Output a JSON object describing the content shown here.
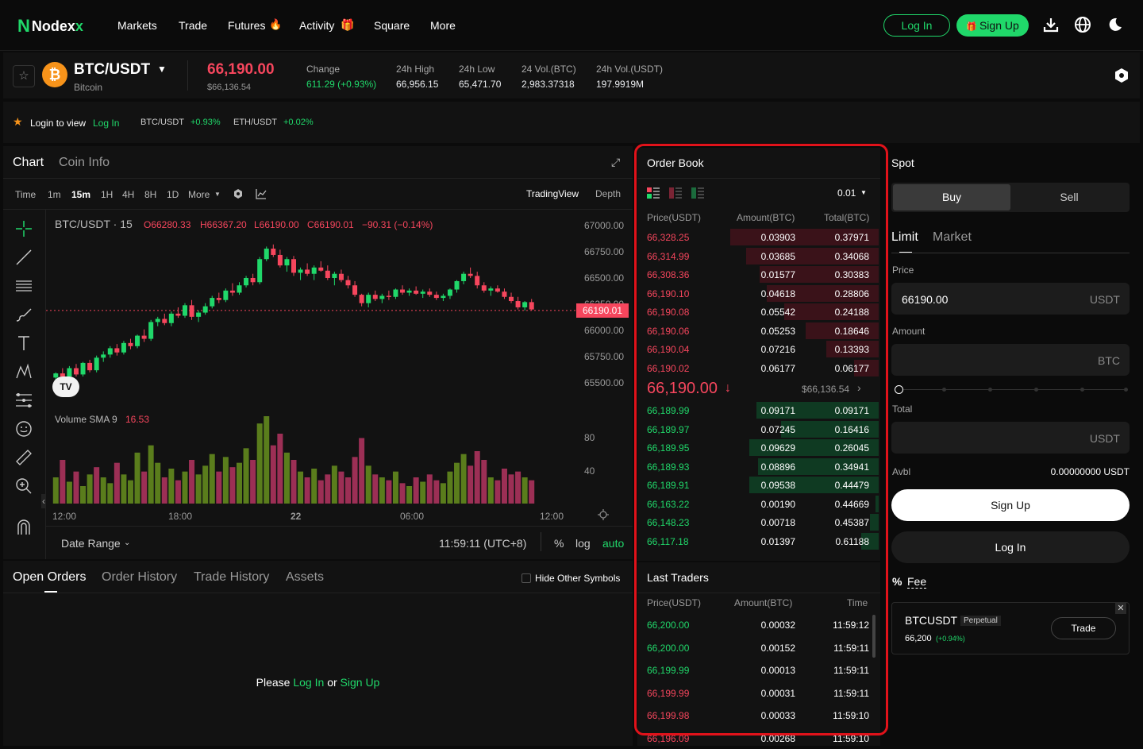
{
  "nav": {
    "logo_prefix": "Nodex",
    "logo_suffix": "x",
    "links": [
      "Markets",
      "Trade",
      "Futures",
      "Activity",
      "Square",
      "More"
    ],
    "login_label": "Log In",
    "signup_label": "Sign Up"
  },
  "ticker": {
    "pair": "BTC/USDT",
    "coin_name": "Bitcoin",
    "coin_symbol": "₿",
    "price": "66,190.00",
    "price_usd": "$66,136.54",
    "change_label": "Change",
    "change_value": "611.29 (+0.93%)",
    "high_label": "24h High",
    "high_value": "66,956.15",
    "low_label": "24h Low",
    "low_value": "65,471.70",
    "vol_btc_label": "24 Vol.(BTC)",
    "vol_btc_value": "2,983.37318",
    "vol_usdt_label": "24h Vol.(USDT)",
    "vol_usdt_value": "197.9919M"
  },
  "ticker_row": {
    "login_prompt": "Login to view",
    "login_link": "Log In",
    "items": [
      {
        "pair": "BTC/USDT",
        "change": "+0.93%"
      },
      {
        "pair": "ETH/USDT",
        "change": "+0.02%"
      }
    ]
  },
  "chart_panel": {
    "tab_chart": "Chart",
    "tab_coin_info": "Coin Info",
    "timeframes": [
      "Time",
      "1m",
      "15m",
      "1H",
      "4H",
      "8H",
      "1D",
      "More"
    ],
    "active_timeframe": "15m",
    "view_tradingview": "TradingView",
    "view_depth": "Depth",
    "symbol_label": "BTC/USDT · 15",
    "ohlc": {
      "o": "O66280.33",
      "h": "H66367.20",
      "l": "L66190.00",
      "c": "C66190.01",
      "chg": "−90.31 (−0.14%)"
    },
    "price_tag": "66190.01",
    "volume_label": "Volume SMA 9",
    "volume_value": "16.53",
    "date_range": "Date Range",
    "clock": "11:59:11 (UTC+8)",
    "opt_percent": "%",
    "opt_log": "log",
    "opt_auto": "auto",
    "tv_badge": "TV"
  },
  "chart_data": {
    "type": "candlestick",
    "title": "BTC/USDT · 15",
    "xlabel": "",
    "ylabel": "",
    "price_ticks": [
      "67000.00",
      "66750.00",
      "66500.00",
      "66250.00",
      "66000.00",
      "65750.00",
      "65500.00"
    ],
    "volume_ticks": [
      "80",
      "40"
    ],
    "x_ticks": [
      "12:00",
      "18:00",
      "22",
      "06:00",
      "12:00"
    ],
    "ylim": [
      65500,
      67000
    ],
    "colors": {
      "up": "#20d86a",
      "down": "#f6465d",
      "vol_up": "#5a7d1c",
      "vol_down": "#9c2f55"
    },
    "candles": [
      [
        65550,
        65600,
        65470,
        65590
      ],
      [
        65590,
        65640,
        65540,
        65560
      ],
      [
        65560,
        65660,
        65540,
        65640
      ],
      [
        65640,
        65680,
        65560,
        65580
      ],
      [
        65580,
        65700,
        65560,
        65690
      ],
      [
        65690,
        65720,
        65600,
        65620
      ],
      [
        65620,
        65760,
        65600,
        65740
      ],
      [
        65740,
        65800,
        65700,
        65770
      ],
      [
        65770,
        65850,
        65740,
        65830
      ],
      [
        65830,
        65870,
        65760,
        65790
      ],
      [
        65790,
        65900,
        65770,
        65880
      ],
      [
        65880,
        65920,
        65820,
        65850
      ],
      [
        65850,
        65960,
        65830,
        65950
      ],
      [
        65950,
        66010,
        65890,
        65920
      ],
      [
        65920,
        66100,
        65900,
        66080
      ],
      [
        66080,
        66130,
        66040,
        66110
      ],
      [
        66110,
        66160,
        66050,
        66070
      ],
      [
        66070,
        66180,
        66040,
        66160
      ],
      [
        66160,
        66220,
        66120,
        66140
      ],
      [
        66140,
        66260,
        66120,
        66240
      ],
      [
        66240,
        66290,
        66100,
        66130
      ],
      [
        66130,
        66190,
        66080,
        66170
      ],
      [
        66170,
        66260,
        66150,
        66230
      ],
      [
        66230,
        66330,
        66210,
        66310
      ],
      [
        66310,
        66360,
        66260,
        66290
      ],
      [
        66290,
        66400,
        66270,
        66380
      ],
      [
        66380,
        66450,
        66330,
        66360
      ],
      [
        66360,
        66460,
        66340,
        66430
      ],
      [
        66430,
        66520,
        66410,
        66500
      ],
      [
        66500,
        66540,
        66430,
        66460
      ],
      [
        66460,
        66700,
        66440,
        66680
      ],
      [
        66680,
        66800,
        66660,
        66780
      ],
      [
        66780,
        66820,
        66700,
        66720
      ],
      [
        66720,
        66770,
        66600,
        66620
      ],
      [
        66620,
        66700,
        66560,
        66680
      ],
      [
        66680,
        66710,
        66520,
        66550
      ],
      [
        66550,
        66600,
        66480,
        66580
      ],
      [
        66580,
        66640,
        66520,
        66540
      ],
      [
        66540,
        66620,
        66480,
        66600
      ],
      [
        66600,
        66660,
        66560,
        66570
      ],
      [
        66570,
        66620,
        66480,
        66500
      ],
      [
        66500,
        66560,
        66430,
        66540
      ],
      [
        66540,
        66580,
        66460,
        66480
      ],
      [
        66480,
        66520,
        66400,
        66430
      ],
      [
        66430,
        66470,
        66320,
        66340
      ],
      [
        66340,
        66350,
        66230,
        66260
      ],
      [
        66260,
        66360,
        66220,
        66340
      ],
      [
        66340,
        66380,
        66280,
        66300
      ],
      [
        66300,
        66350,
        66260,
        66330
      ],
      [
        66330,
        66380,
        66290,
        66320
      ],
      [
        66320,
        66400,
        66300,
        66390
      ],
      [
        66390,
        66430,
        66340,
        66360
      ],
      [
        66360,
        66400,
        66330,
        66380
      ],
      [
        66380,
        66420,
        66340,
        66350
      ],
      [
        66350,
        66390,
        66310,
        66370
      ],
      [
        66370,
        66400,
        66320,
        66340
      ],
      [
        66340,
        66370,
        66290,
        66310
      ],
      [
        66310,
        66350,
        66280,
        66330
      ],
      [
        66330,
        66400,
        66300,
        66390
      ],
      [
        66390,
        66480,
        66360,
        66470
      ],
      [
        66470,
        66560,
        66440,
        66540
      ],
      [
        66540,
        66600,
        66500,
        66520
      ],
      [
        66520,
        66560,
        66400,
        66430
      ],
      [
        66430,
        66460,
        66360,
        66380
      ],
      [
        66380,
        66420,
        66330,
        66400
      ],
      [
        66400,
        66430,
        66360,
        66370
      ],
      [
        66370,
        66400,
        66300,
        66320
      ],
      [
        66320,
        66360,
        66260,
        66280
      ],
      [
        66280,
        66320,
        66200,
        66220
      ],
      [
        66220,
        66280,
        66190,
        66270
      ],
      [
        66270,
        66300,
        66190,
        66200
      ]
    ],
    "volumes": [
      [
        18,
        1
      ],
      [
        30,
        0
      ],
      [
        15,
        1
      ],
      [
        22,
        0
      ],
      [
        12,
        1
      ],
      [
        20,
        1
      ],
      [
        25,
        0
      ],
      [
        18,
        1
      ],
      [
        14,
        1
      ],
      [
        28,
        0
      ],
      [
        20,
        1
      ],
      [
        16,
        1
      ],
      [
        35,
        1
      ],
      [
        22,
        0
      ],
      [
        40,
        1
      ],
      [
        28,
        1
      ],
      [
        18,
        0
      ],
      [
        24,
        1
      ],
      [
        16,
        0
      ],
      [
        22,
        1
      ],
      [
        30,
        0
      ],
      [
        20,
        1
      ],
      [
        26,
        1
      ],
      [
        34,
        1
      ],
      [
        22,
        0
      ],
      [
        32,
        1
      ],
      [
        25,
        0
      ],
      [
        28,
        1
      ],
      [
        38,
        1
      ],
      [
        30,
        0
      ],
      [
        55,
        1
      ],
      [
        60,
        1
      ],
      [
        40,
        0
      ],
      [
        48,
        0
      ],
      [
        35,
        1
      ],
      [
        30,
        0
      ],
      [
        22,
        1
      ],
      [
        18,
        0
      ],
      [
        24,
        1
      ],
      [
        16,
        0
      ],
      [
        20,
        0
      ],
      [
        26,
        1
      ],
      [
        22,
        0
      ],
      [
        18,
        0
      ],
      [
        32,
        0
      ],
      [
        45,
        0
      ],
      [
        26,
        1
      ],
      [
        20,
        0
      ],
      [
        18,
        1
      ],
      [
        16,
        0
      ],
      [
        22,
        1
      ],
      [
        14,
        0
      ],
      [
        12,
        1
      ],
      [
        18,
        0
      ],
      [
        15,
        1
      ],
      [
        20,
        0
      ],
      [
        16,
        0
      ],
      [
        14,
        1
      ],
      [
        22,
        1
      ],
      [
        28,
        1
      ],
      [
        34,
        1
      ],
      [
        26,
        0
      ],
      [
        36,
        0
      ],
      [
        30,
        0
      ],
      [
        18,
        1
      ],
      [
        16,
        0
      ],
      [
        24,
        0
      ],
      [
        20,
        0
      ],
      [
        22,
        0
      ],
      [
        18,
        1
      ],
      [
        16,
        0
      ]
    ]
  },
  "orders_panel": {
    "tabs": [
      "Open Orders",
      "Order History",
      "Trade History",
      "Assets"
    ],
    "hide_label": "Hide Other Symbols",
    "empty_prefix": "Please",
    "empty_login": "Log In",
    "empty_or": "or",
    "empty_signup": "Sign Up"
  },
  "order_book": {
    "title": "Order Book",
    "precision": "0.01",
    "headers": [
      "Price(USDT)",
      "Amount(BTC)",
      "Total(BTC)"
    ],
    "asks": [
      {
        "price": "66,328.25",
        "amount": "0.03903",
        "total": "0.37971",
        "depth": 0.85
      },
      {
        "price": "66,314.99",
        "amount": "0.03685",
        "total": "0.34068",
        "depth": 0.76
      },
      {
        "price": "66,308.36",
        "amount": "0.01577",
        "total": "0.30383",
        "depth": 0.68
      },
      {
        "price": "66,190.10",
        "amount": "0.04618",
        "total": "0.28806",
        "depth": 0.64
      },
      {
        "price": "66,190.08",
        "amount": "0.05542",
        "total": "0.24188",
        "depth": 0.54
      },
      {
        "price": "66,190.06",
        "amount": "0.05253",
        "total": "0.18646",
        "depth": 0.42
      },
      {
        "price": "66,190.04",
        "amount": "0.07216",
        "total": "0.13393",
        "depth": 0.3
      },
      {
        "price": "66,190.02",
        "amount": "0.06177",
        "total": "0.06177",
        "depth": 0.14
      }
    ],
    "mid_price": "66,190.00",
    "mid_arrow": "↓",
    "mid_usd": "$66,136.54",
    "bids": [
      {
        "price": "66,189.99",
        "amount": "0.09171",
        "total": "0.09171",
        "depth": 0.7
      },
      {
        "price": "66,189.97",
        "amount": "0.07245",
        "total": "0.16416",
        "depth": 0.56
      },
      {
        "price": "66,189.95",
        "amount": "0.09629",
        "total": "0.26045",
        "depth": 0.74
      },
      {
        "price": "66,189.93",
        "amount": "0.08896",
        "total": "0.34941",
        "depth": 0.69
      },
      {
        "price": "66,189.91",
        "amount": "0.09538",
        "total": "0.44479",
        "depth": 0.74
      },
      {
        "price": "66,163.22",
        "amount": "0.00190",
        "total": "0.44669",
        "depth": 0.015
      },
      {
        "price": "66,148.23",
        "amount": "0.00718",
        "total": "0.45387",
        "depth": 0.05
      },
      {
        "price": "66,117.18",
        "amount": "0.01397",
        "total": "0.61188",
        "depth": 0.1
      }
    ]
  },
  "last_traders": {
    "title": "Last Traders",
    "headers": [
      "Price(USDT)",
      "Amount(BTC)",
      "Time"
    ],
    "rows": [
      {
        "price": "66,200.00",
        "amount": "0.00032",
        "time": "11:59:12",
        "side": "buy"
      },
      {
        "price": "66,200.00",
        "amount": "0.00152",
        "time": "11:59:11",
        "side": "buy"
      },
      {
        "price": "66,199.99",
        "amount": "0.00013",
        "time": "11:59:11",
        "side": "buy"
      },
      {
        "price": "66,199.99",
        "amount": "0.00031",
        "time": "11:59:11",
        "side": "sell"
      },
      {
        "price": "66,199.98",
        "amount": "0.00033",
        "time": "11:59:10",
        "side": "sell"
      },
      {
        "price": "66,196.09",
        "amount": "0.00268",
        "time": "11:59:10",
        "side": "sell"
      }
    ]
  },
  "spot": {
    "title": "Spot",
    "buy": "Buy",
    "sell": "Sell",
    "tab_limit": "Limit",
    "tab_market": "Market",
    "price_label": "Price",
    "price_value": "66190.00",
    "price_unit": "USDT",
    "amount_label": "Amount",
    "amount_unit": "BTC",
    "total_label": "Total",
    "total_unit": "USDT",
    "avbl_label": "Avbl",
    "avbl_value": "0.00000000 USDT",
    "signup_btn": "Sign Up",
    "login_btn": "Log In",
    "fee_icon": "%",
    "fee_label": "Fee",
    "promo_symbol": "BTCUSDT",
    "promo_tag": "Perpetual",
    "promo_price": "66,200",
    "promo_change": "(+0.94%)",
    "promo_trade": "Trade"
  }
}
